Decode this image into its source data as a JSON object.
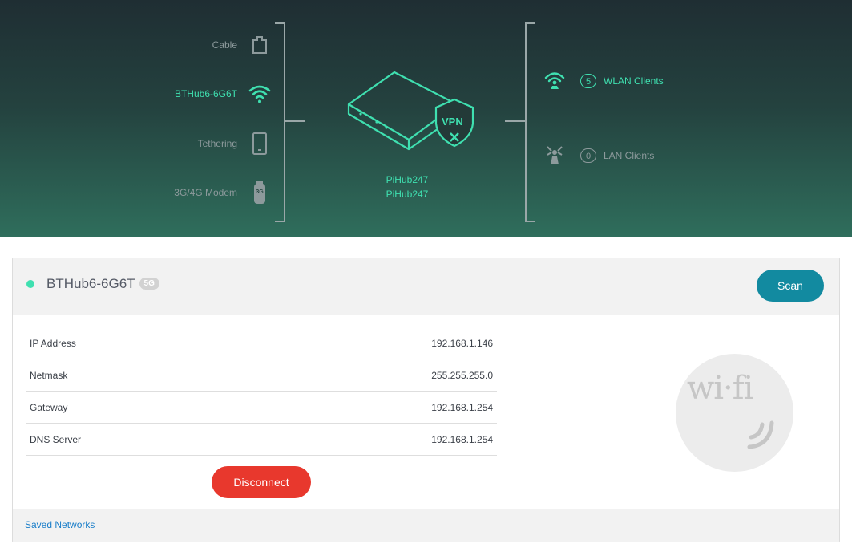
{
  "sources": [
    {
      "label": "Cable",
      "icon": "ethernet-port-icon",
      "active": false
    },
    {
      "label": "BTHub6-6G6T",
      "icon": "wifi-icon",
      "active": true
    },
    {
      "label": "Tethering",
      "icon": "phone-icon",
      "active": false
    },
    {
      "label": "3G/4G Modem",
      "icon": "usb-modem-icon",
      "active": false
    }
  ],
  "device": {
    "badge": "VPN",
    "host_line1": "PiHub247",
    "host_line2": "PiHub247"
  },
  "clients": [
    {
      "count": "5",
      "label": "WLAN Clients",
      "icon": "wireless-router-icon",
      "active": true
    },
    {
      "count": "0",
      "label": "LAN Clients",
      "icon": "lan-router-icon",
      "active": false
    }
  ],
  "network": {
    "name": "BTHub6-6G6T",
    "band": "5G",
    "scan_label": "Scan",
    "rows": [
      {
        "label": "IP Address",
        "value": "192.168.1.146"
      },
      {
        "label": "Netmask",
        "value": "255.255.255.0"
      },
      {
        "label": "Gateway",
        "value": "192.168.1.254"
      },
      {
        "label": "DNS Server",
        "value": "192.168.1.254"
      }
    ],
    "disconnect_label": "Disconnect",
    "logo_text": "wi·fi"
  },
  "footer": {
    "saved_networks": "Saved Networks"
  },
  "colors": {
    "accent": "#3fe0b0",
    "scan": "#128aa0",
    "disconnect": "#e8382d",
    "link": "#1a7ec9"
  }
}
